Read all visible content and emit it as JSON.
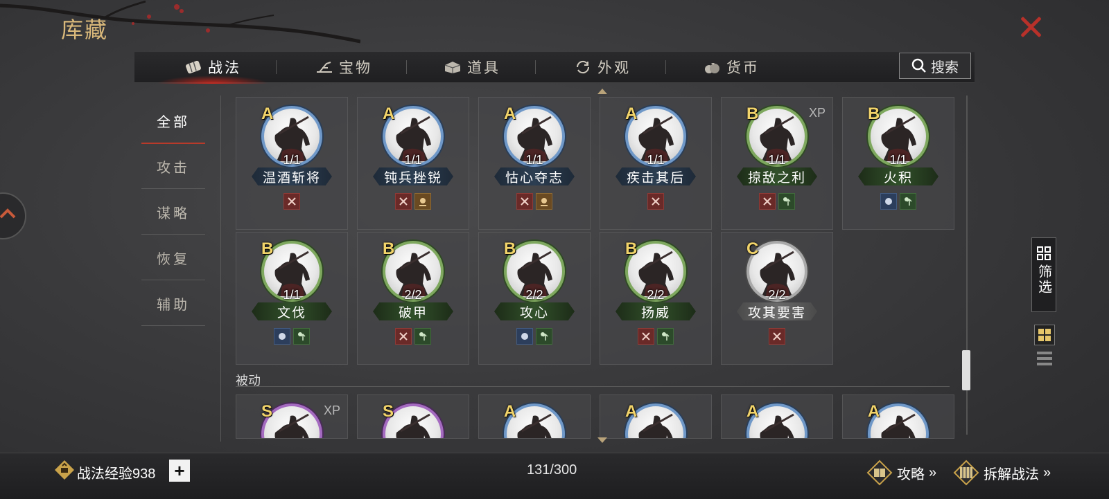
{
  "header": {
    "title": "库藏"
  },
  "tabs": [
    {
      "label": "战法",
      "icon": "scroll-bundle-icon",
      "active": true
    },
    {
      "label": "宝物",
      "icon": "plow-icon",
      "active": false
    },
    {
      "label": "道具",
      "icon": "chest-icon",
      "active": false
    },
    {
      "label": "外观",
      "icon": "cycle-icon",
      "active": false
    },
    {
      "label": "货币",
      "icon": "money-bag-icon",
      "active": false
    }
  ],
  "search": {
    "label": "搜索"
  },
  "sidebar": {
    "items": [
      {
        "label": "全部",
        "active": true
      },
      {
        "label": "攻击",
        "active": false
      },
      {
        "label": "谋略",
        "active": false
      },
      {
        "label": "恢复",
        "active": false
      },
      {
        "label": "辅助",
        "active": false
      }
    ]
  },
  "cards": [
    {
      "rank": "A",
      "count": "1/1",
      "name": "温酒斩将",
      "xp": "",
      "tags": [
        "attack"
      ]
    },
    {
      "rank": "A",
      "count": "1/1",
      "name": "钝兵挫锐",
      "xp": "",
      "tags": [
        "attack",
        "crowd"
      ]
    },
    {
      "rank": "A",
      "count": "1/1",
      "name": "怙心夺志",
      "xp": "",
      "tags": [
        "attack",
        "crowd"
      ]
    },
    {
      "rank": "A",
      "count": "1/1",
      "name": "疾击其后",
      "xp": "",
      "tags": [
        "attack"
      ]
    },
    {
      "rank": "B",
      "count": "1/1",
      "name": "掠敌之利",
      "xp": "XP",
      "tags": [
        "attack",
        "heal"
      ]
    },
    {
      "rank": "B",
      "count": "1/1",
      "name": "火积",
      "xp": "",
      "tags": [
        "mind",
        "heal"
      ]
    },
    {
      "rank": "B",
      "count": "1/1",
      "name": "文伐",
      "xp": "",
      "tags": [
        "mind",
        "heal"
      ]
    },
    {
      "rank": "B",
      "count": "2/2",
      "name": "破甲",
      "xp": "",
      "tags": [
        "attack",
        "heal"
      ]
    },
    {
      "rank": "B",
      "count": "2/2",
      "name": "攻心",
      "xp": "",
      "tags": [
        "mind",
        "heal"
      ]
    },
    {
      "rank": "B",
      "count": "2/2",
      "name": "扬威",
      "xp": "",
      "tags": [
        "attack",
        "heal"
      ]
    },
    {
      "rank": "C",
      "count": "2/2",
      "name": "攻其要害",
      "xp": "",
      "tags": [
        "attack"
      ]
    }
  ],
  "passive_section": {
    "title": "被动"
  },
  "passive_cards": [
    {
      "rank": "S",
      "xp": "XP"
    },
    {
      "rank": "S",
      "xp": ""
    },
    {
      "rank": "A",
      "xp": ""
    },
    {
      "rank": "A",
      "xp": ""
    },
    {
      "rank": "A",
      "xp": ""
    },
    {
      "rank": "A",
      "xp": ""
    }
  ],
  "filter": {
    "label": "筛选"
  },
  "footer": {
    "exp_label": "战法经验938",
    "plus": "+",
    "capacity": "131/300",
    "guide": "攻略",
    "decompose": "拆解战法"
  },
  "colors": {
    "accent_red": "#b8312a",
    "title_gold": "#d9b87a",
    "rank_gold": "#f2d46a",
    "ring_A": "#6f98c8",
    "ring_B": "#7ea85e",
    "ring_C": "#a9a9a9",
    "ring_S": "#a46ac0"
  }
}
